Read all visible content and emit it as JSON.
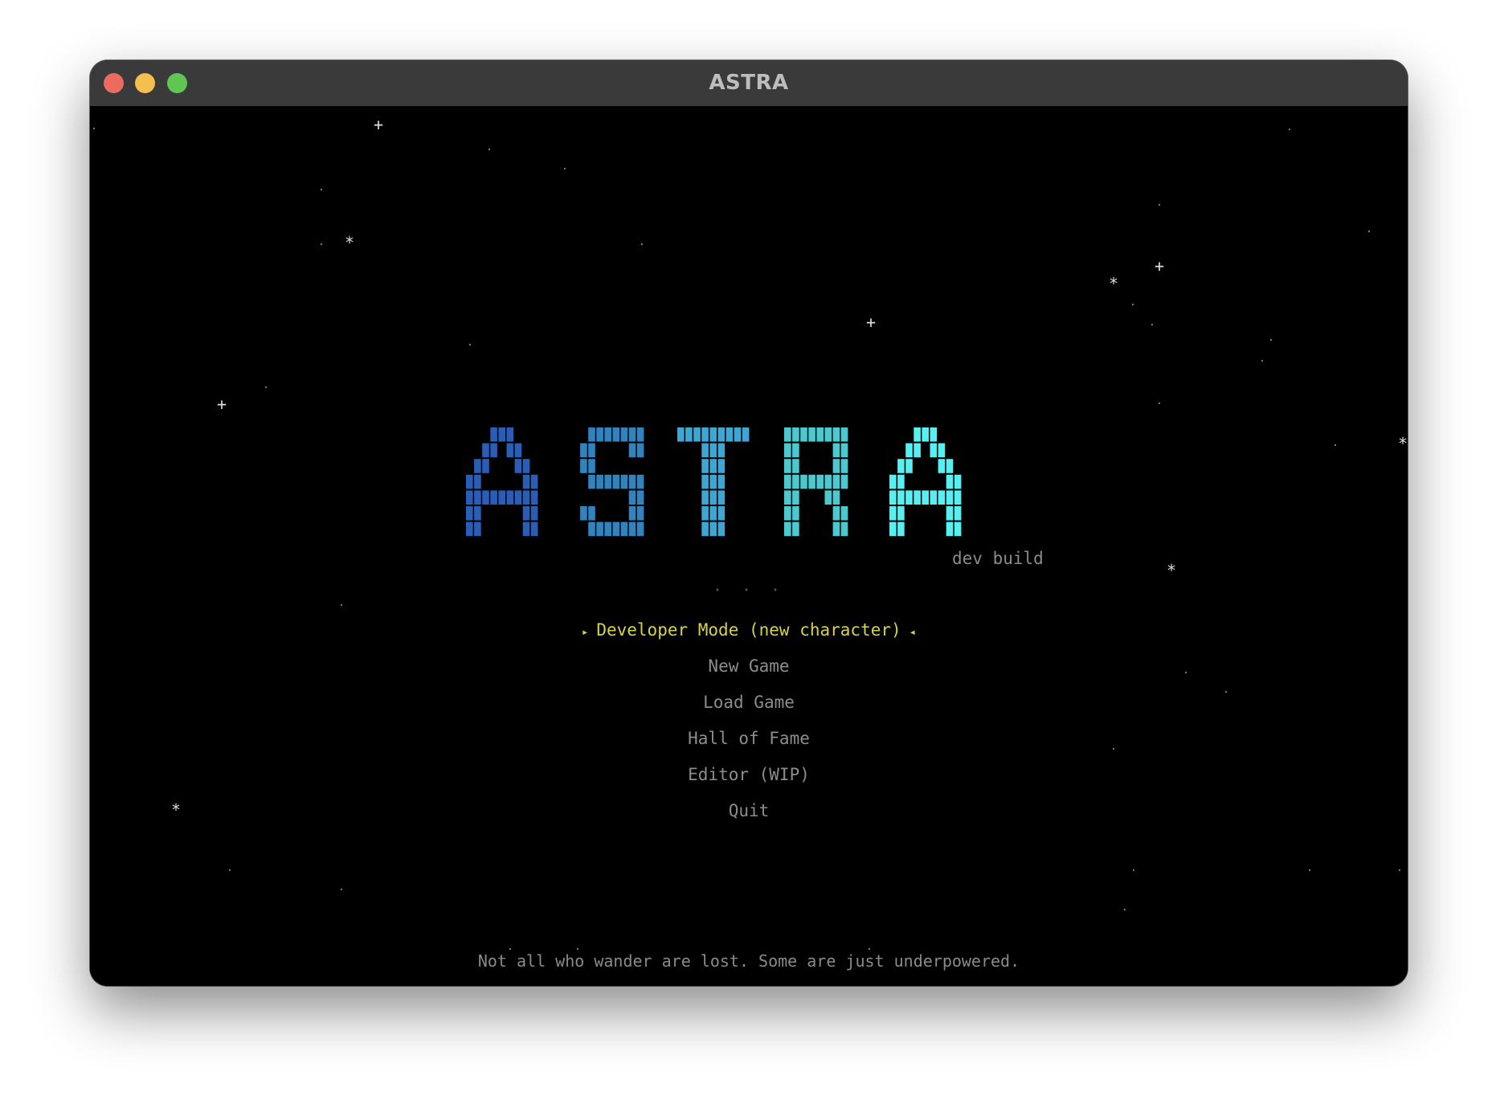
{
  "window": {
    "title": "ASTRA",
    "buttons": {
      "close_color": "#ed6a5e",
      "minimize_color": "#f5bf4f",
      "zoom_color": "#61c554"
    }
  },
  "logo": {
    "text": "ASTRA",
    "letter_colors": [
      "#2a5db4",
      "#3183bd",
      "#3ea6d4",
      "#4cc8cf",
      "#55f0f2"
    ],
    "subtitle": "dev build"
  },
  "separator": "· · ·",
  "menu": {
    "selected_index": 0,
    "selector_left": "▸",
    "selector_right": "◂",
    "items": [
      {
        "label": "Developer Mode (new character)"
      },
      {
        "label": "New Game"
      },
      {
        "label": "Load Game"
      },
      {
        "label": "Hall of Fame"
      },
      {
        "label": "Editor (WIP)"
      },
      {
        "label": "Quit"
      }
    ]
  },
  "tagline": "Not all who wander are lost. Some are just underpowered.",
  "colors": {
    "background": "#000000",
    "menu_text": "#8c8c8c",
    "menu_selected": "#d6d34a",
    "star": "#dddddd"
  }
}
